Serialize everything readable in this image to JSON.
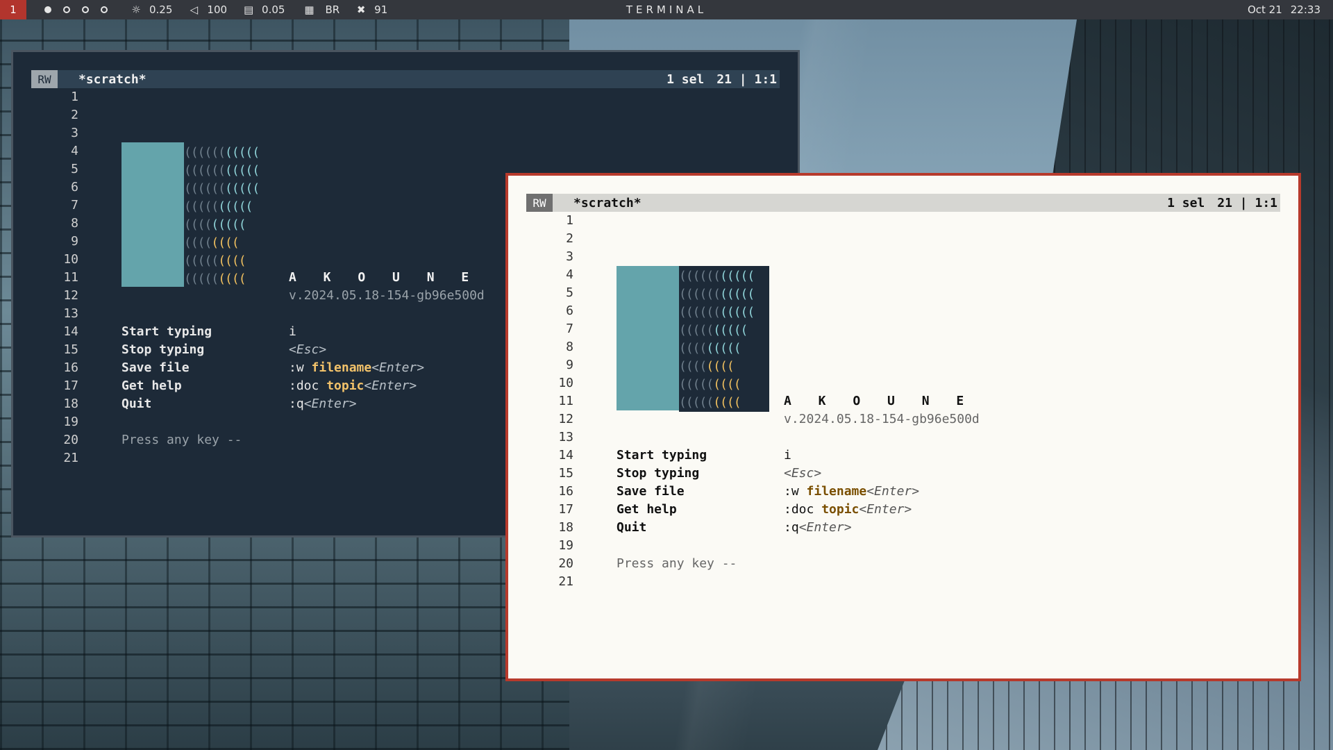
{
  "topbar": {
    "current_tag": "1",
    "brightness": "0.25",
    "volume": "100",
    "memory": "0.05",
    "keyboard_layout": "BR",
    "temp": "91",
    "title": "TERMINAL",
    "date": "Oct 21",
    "time": "22:33"
  },
  "editor": {
    "mode": "RW",
    "buffer": "*scratch*",
    "selections": "1 sel",
    "line_count": "21",
    "sep": "|",
    "cursor": "1:1",
    "line_numbers": [
      "1",
      "2",
      "3",
      "4",
      "5",
      "6",
      "7",
      "8",
      "9",
      "10",
      "11",
      "12",
      "13",
      "14",
      "15",
      "16",
      "17",
      "18",
      "19",
      "20",
      "21"
    ],
    "brand": "A K O U N E",
    "version": "v.2024.05.18-154-gb96e500d",
    "help": [
      {
        "action": "Start typing",
        "cmd": "i",
        "arg": "",
        "key": ""
      },
      {
        "action": "Stop typing",
        "cmd": "",
        "arg": "",
        "key": "<Esc>"
      },
      {
        "action": "Save file",
        "cmd": ":w ",
        "arg": "filename",
        "key": "<Enter>"
      },
      {
        "action": "Get help",
        "cmd": ":doc ",
        "arg": "topic",
        "key": "<Enter>"
      },
      {
        "action": "Quit",
        "cmd": ":q",
        "arg": "",
        "key": "<Enter>"
      }
    ],
    "press_any_key": "Press any key --",
    "logo_rows": [
      [
        "((((((",
        "(((((",
        ""
      ],
      [
        "((((((",
        "(((((",
        ""
      ],
      [
        "((((((",
        "(((((",
        ""
      ],
      [
        "(((((",
        "(((((",
        ""
      ],
      [
        "((((",
        "(((((",
        ""
      ],
      [
        "((((",
        "((((",
        ""
      ],
      [
        "(((((",
        "((((",
        ""
      ],
      [
        "(((((",
        "((((",
        ""
      ]
    ]
  }
}
